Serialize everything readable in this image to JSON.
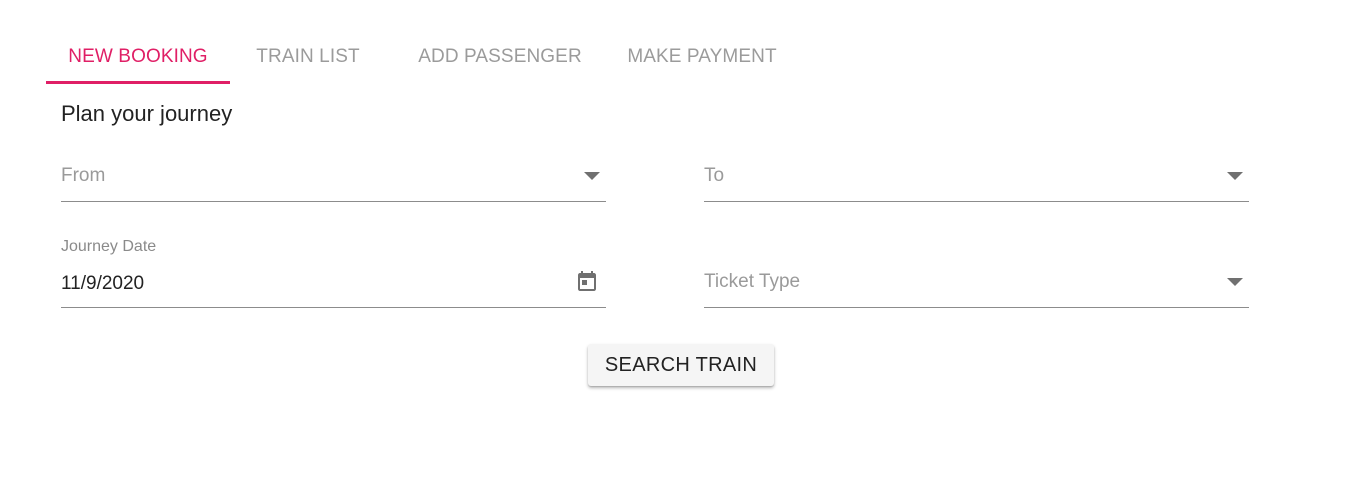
{
  "tabs": [
    {
      "label": "NEW BOOKING",
      "active": true
    },
    {
      "label": "TRAIN LIST",
      "active": false
    },
    {
      "label": "ADD PASSENGER",
      "active": false
    },
    {
      "label": "MAKE PAYMENT",
      "active": false
    }
  ],
  "accent_color": "#e01f66",
  "section_title": "Plan your journey",
  "form": {
    "from": {
      "placeholder": "From",
      "icon": "chevron-down-icon"
    },
    "to": {
      "placeholder": "To",
      "icon": "chevron-down-icon"
    },
    "journey_date": {
      "label": "Journey Date",
      "value": "11/9/2020",
      "icon": "calendar-icon"
    },
    "ticket_type": {
      "placeholder": "Ticket Type",
      "icon": "chevron-down-icon"
    }
  },
  "search_button_label": "SEARCH TRAIN"
}
